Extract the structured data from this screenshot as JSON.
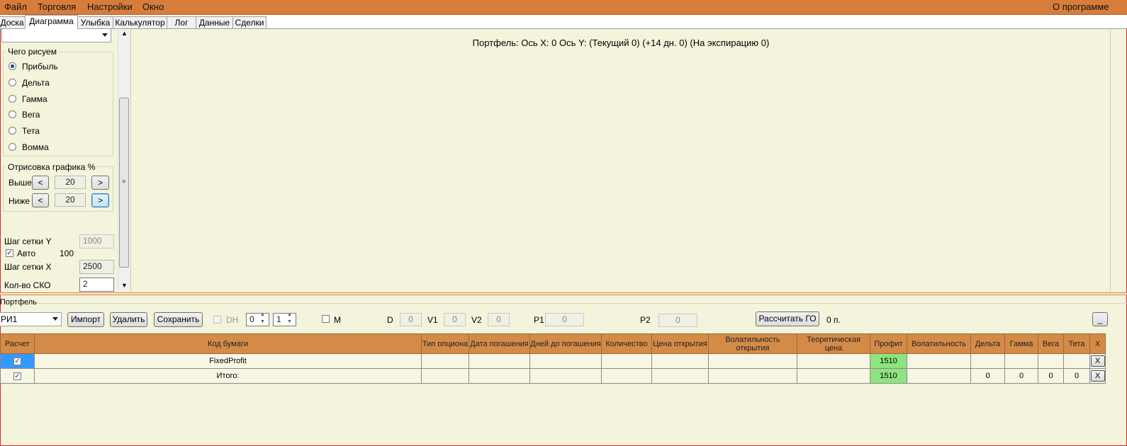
{
  "menu": {
    "items": [
      "Файл",
      "Торговля",
      "Настройки",
      "Окно"
    ],
    "about": "О программе"
  },
  "tabs": [
    "Доска",
    "Диаграмма",
    "Улыбка",
    "Калькулятор",
    "Лог",
    "Данные",
    "Сделки"
  ],
  "active_tab": "Диаграмма",
  "left_panel": {
    "selector_value": "",
    "draw_group": {
      "title": "Чего рисуем",
      "options": [
        "Прибыль",
        "Дельта",
        "Гамма",
        "Вега",
        "Тета",
        "Вомма"
      ],
      "selected": "Прибыль"
    },
    "chart_render_group": {
      "title": "Отрисовка графика %",
      "above_label": "Выше",
      "above_value": "20",
      "below_label": "Ниже",
      "below_value": "20",
      "dec_label": "<",
      "inc_label": ">"
    },
    "grid_step_y_label": "Шаг сетки Y",
    "grid_step_y_value": "1000",
    "auto_label": "Авто",
    "auto_checked": true,
    "auto_value": "100",
    "grid_step_x_label": "Шаг сетки X",
    "grid_step_x_value": "2500",
    "sko_label": "Кол-во СКО",
    "sko_value": "2"
  },
  "chart_area": {
    "header": "Портфель: Ось X: 0 Ось Y:  (Текущий 0)  (+14 дн. 0)  (На экспирацию 0)"
  },
  "portfolio": {
    "section_label": "Портфель",
    "selector_value": "РИ1",
    "import_label": "Импорт",
    "delete_label": "Удалить",
    "save_label": "Сохранить",
    "dh_label": "DH",
    "spin1_value": "0",
    "spin2_value": "1",
    "m_label": "M",
    "d_label": "D",
    "d_value": "0",
    "v1_label": "V1",
    "v1_value": "0",
    "v2_label": "V2",
    "v2_value": "0",
    "p1_label": "P1",
    "p1_value": "0",
    "p2_label": "P2",
    "p2_value": "0",
    "calc_go_label": "Рассчитать ГО",
    "go_value": "0 п.",
    "minimize_label": "_"
  },
  "grid": {
    "columns": [
      "Расчет",
      "Код бумаги",
      "Тип опциона",
      "Дата погашения",
      "Дней до погашения",
      "Количество",
      "Цена открытия",
      "Волатильность открытия",
      "Теоретическая цена",
      "Профит",
      "Волатильность",
      "Дельта",
      "Гамма",
      "Вега",
      "Тета",
      "X"
    ],
    "rows": [
      {
        "code": "FixedProfit",
        "profit": "1510",
        "delta": "",
        "gamma": "",
        "vega": "",
        "theta": "",
        "x": "X"
      },
      {
        "code": "Итого:",
        "profit": "1510",
        "delta": "0",
        "gamma": "0",
        "vega": "0",
        "theta": "0",
        "x": "X"
      }
    ]
  },
  "colors": {
    "menu_bar": "#d77d3b",
    "header": "#d48b47",
    "profit_cell": "#8ee47f",
    "background": "#f4f3dc"
  }
}
